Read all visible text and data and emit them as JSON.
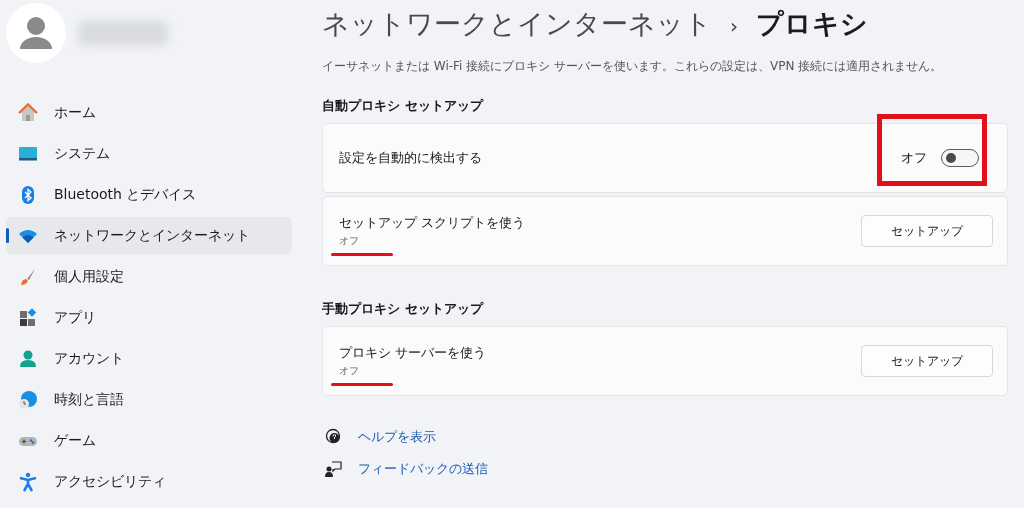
{
  "sidebar": {
    "items": [
      {
        "label": "ホーム",
        "kind": "home",
        "selected": false
      },
      {
        "label": "システム",
        "kind": "system",
        "selected": false
      },
      {
        "label": "Bluetooth とデバイス",
        "kind": "bluetooth",
        "selected": false
      },
      {
        "label": "ネットワークとインターネット",
        "kind": "wifi",
        "selected": true
      },
      {
        "label": "個人用設定",
        "kind": "brush",
        "selected": false
      },
      {
        "label": "アプリ",
        "kind": "apps",
        "selected": false
      },
      {
        "label": "アカウント",
        "kind": "account",
        "selected": false
      },
      {
        "label": "時刻と言語",
        "kind": "time",
        "selected": false
      },
      {
        "label": "ゲーム",
        "kind": "game",
        "selected": false
      },
      {
        "label": "アクセシビリティ",
        "kind": "accessibility",
        "selected": false
      }
    ]
  },
  "breadcrumb": {
    "parent": "ネットワークとインターネット",
    "separator": "›",
    "current": "プロキシ"
  },
  "description": "イーサネットまたは Wi-Fi 接続にプロキシ サーバーを使います。これらの設定は、VPN 接続には適用されません。",
  "sections": [
    {
      "heading": "自動プロキシ セットアップ",
      "cards": [
        {
          "kind": "toggle",
          "title": "設定を自動的に検出する",
          "state_label": "オフ",
          "on": false,
          "annotated": true
        },
        {
          "kind": "button",
          "title": "セットアップ スクリプトを使う",
          "status": "オフ",
          "button": "セットアップ",
          "annotated": true
        }
      ]
    },
    {
      "heading": "手動プロキシ セットアップ",
      "cards": [
        {
          "kind": "button",
          "title": "プロキシ サーバーを使う",
          "status": "オフ",
          "button": "セットアップ",
          "annotated": true
        }
      ]
    }
  ],
  "links": [
    {
      "label": "ヘルプを表示",
      "kind": "help"
    },
    {
      "label": "フィードバックの送信",
      "kind": "feedback"
    }
  ]
}
